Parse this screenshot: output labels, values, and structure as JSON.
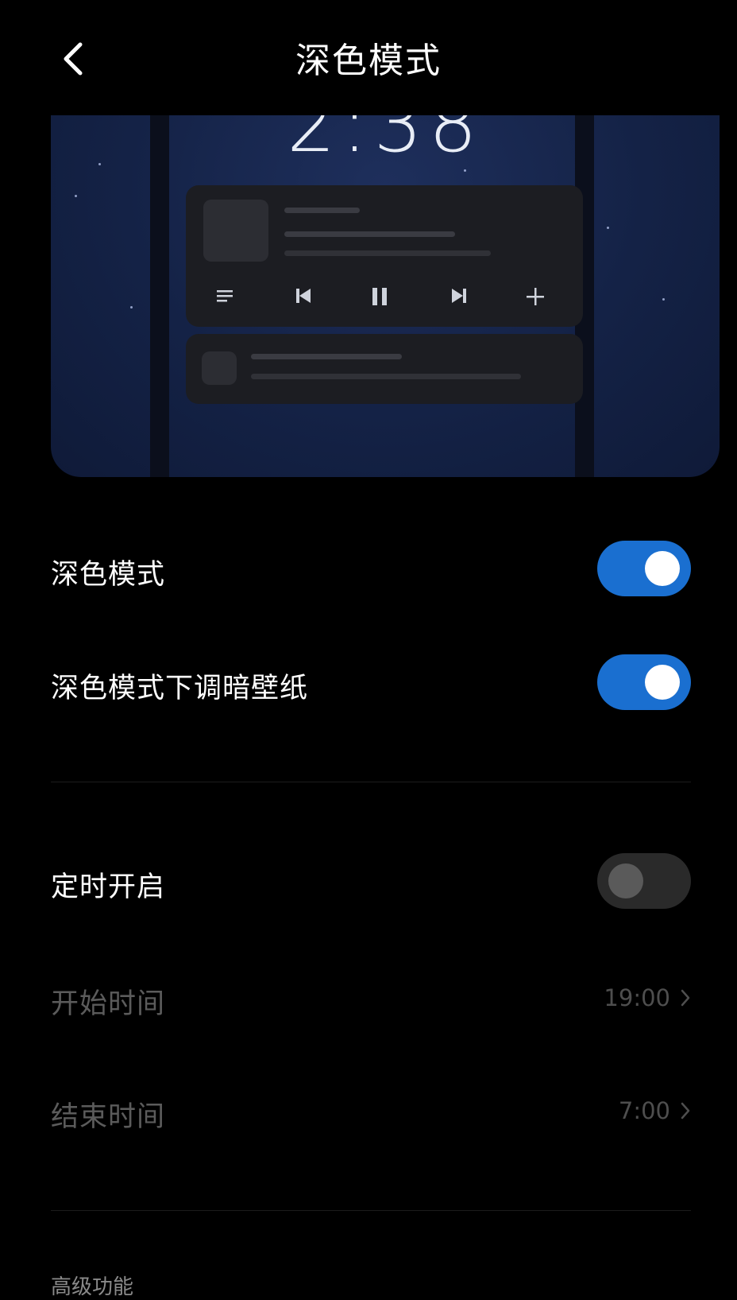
{
  "header": {
    "title": "深色模式",
    "back_icon": "chevron-left-icon"
  },
  "preview": {
    "clock": "2:38",
    "media_controls": [
      "playlist-icon",
      "previous-icon",
      "pause-icon",
      "next-icon",
      "add-icon"
    ]
  },
  "settings": {
    "dark_mode": {
      "label": "深色模式",
      "enabled": true
    },
    "dim_wallpaper": {
      "label": "深色模式下调暗壁纸",
      "enabled": true
    },
    "schedule": {
      "label": "定时开启",
      "enabled": false
    },
    "start_time": {
      "label": "开始时间",
      "value": "19:00"
    },
    "end_time": {
      "label": "结束时间",
      "value": "7:00"
    }
  },
  "sections": {
    "advanced_title": "高级功能"
  },
  "colors": {
    "accent": "#1a6fd0",
    "background": "#000000"
  }
}
